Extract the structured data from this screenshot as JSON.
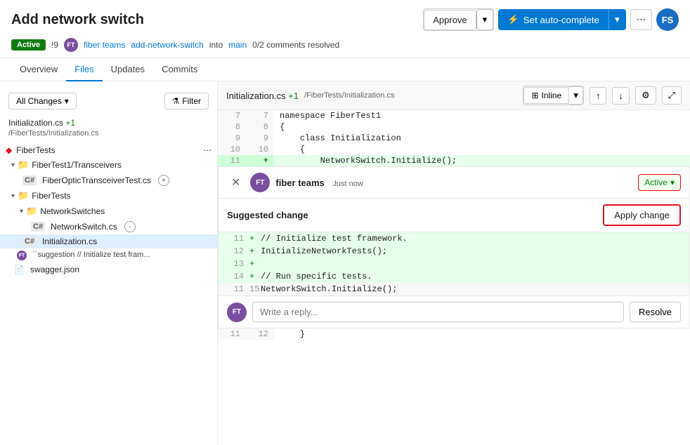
{
  "header": {
    "title": "Add network switch",
    "badge_active": "Active",
    "pr_num": "!9",
    "author_initials": "FT",
    "author_name": "fiber teams",
    "branch_from": "add-network-switch",
    "branch_into": "into",
    "branch_target": "main",
    "comments_resolved": "0/2 comments resolved",
    "btn_approve": "Approve",
    "btn_autocomplete": "Set auto-complete",
    "fs_initials": "FS"
  },
  "tabs": [
    {
      "label": "Overview",
      "active": false
    },
    {
      "label": "Files",
      "active": true
    },
    {
      "label": "Updates",
      "active": false
    },
    {
      "label": "Commits",
      "active": false
    }
  ],
  "sidebar": {
    "all_changes_label": "All Changes",
    "filter_label": "Filter",
    "file_display": "Initialization.cs +1",
    "file_path": "/FiberTests/Initialization.cs",
    "tree": {
      "root_name": "FiberTests",
      "items": [
        {
          "type": "folder",
          "level": 1,
          "name": "FiberTest1/Transceivers",
          "expanded": true
        },
        {
          "type": "cs",
          "level": 2,
          "name": "FiberOpticTransceiverTest.cs",
          "badge": "+"
        },
        {
          "type": "folder",
          "level": 1,
          "name": "FiberTests",
          "expanded": true
        },
        {
          "type": "folder",
          "level": 2,
          "name": "NetworkSwitches",
          "expanded": true
        },
        {
          "type": "cs",
          "level": 3,
          "name": "NetworkSwitch.cs",
          "badge": "-"
        },
        {
          "type": "cs",
          "level": 2,
          "name": "Initialization.cs",
          "selected": true
        },
        {
          "type": "suggestion",
          "level": 3,
          "name": "``suggestion // Initialize test fram..."
        },
        {
          "type": "json",
          "level": 1,
          "name": "swagger.json"
        }
      ]
    }
  },
  "file_toolbar": {
    "file_name": "Initialization.cs",
    "added": "+1",
    "path": "/FiberTests/Initialization.cs",
    "view_mode": "Inline"
  },
  "diff": {
    "lines": [
      {
        "old_num": "7",
        "new_num": "7",
        "content": "namespace FiberTest1",
        "type": "normal"
      },
      {
        "old_num": "8",
        "new_num": "8",
        "content": "{",
        "type": "normal"
      },
      {
        "old_num": "9",
        "new_num": "9",
        "content": "    class Initialization",
        "type": "normal"
      },
      {
        "old_num": "10",
        "new_num": "10",
        "content": "    {",
        "type": "normal"
      },
      {
        "old_num": "11",
        "new_num": "+",
        "content": "        NetworkSwitch.Initialize();",
        "type": "added"
      }
    ]
  },
  "comment": {
    "user_initials": "FT",
    "username": "fiber teams",
    "timestamp": "Just now",
    "active_status": "Active",
    "suggested_change_label": "Suggested change",
    "apply_change_btn": "Apply change",
    "suggestion_lines": [
      {
        "num": "11",
        "plus": "+",
        "content": "        // Initialize test framework.",
        "type": "added"
      },
      {
        "num": "12",
        "plus": "+",
        "content": "        InitializeNetworkTests();",
        "type": "added"
      },
      {
        "num": "13",
        "plus": "+",
        "content": "",
        "type": "added"
      },
      {
        "num": "14",
        "plus": "+",
        "content": "        // Run specific tests.",
        "type": "added"
      },
      {
        "num": "11",
        "plus": "15",
        "content": "        NetworkSwitch.Initialize();",
        "type": "normal"
      }
    ],
    "reply_placeholder": "Write a reply...",
    "resolve_btn": "Resolve"
  },
  "bottom_code": {
    "old_num": "11",
    "new_num": "12",
    "content": "    }"
  }
}
